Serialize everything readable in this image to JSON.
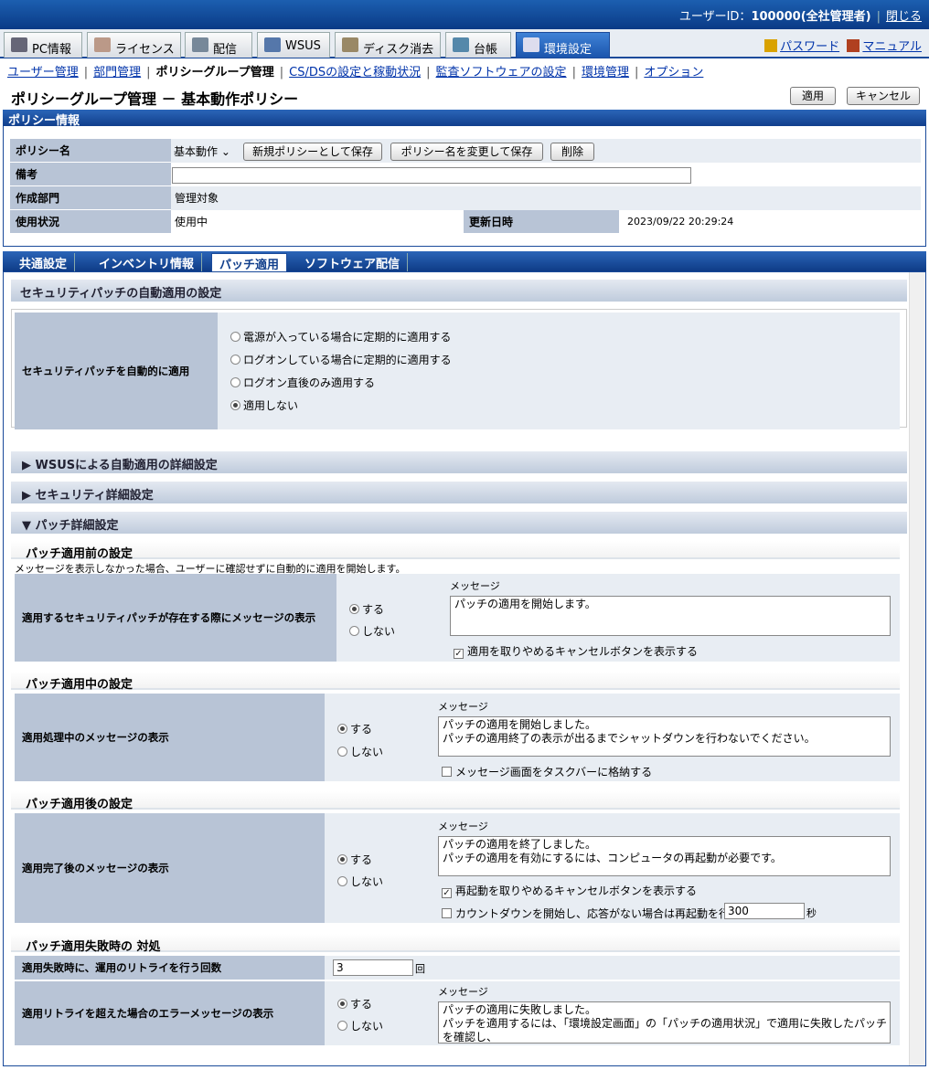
{
  "header": {
    "user_label": "ユーザーID：",
    "user_value": "100000(全社管理者)",
    "logout": "閉じる"
  },
  "main_tabs": [
    {
      "label": "PC情報"
    },
    {
      "label": "ライセンス"
    },
    {
      "label": "配信"
    },
    {
      "label": "WSUS"
    },
    {
      "label": "ディスク消去"
    },
    {
      "label": "台帳"
    },
    {
      "label": "環境設定"
    }
  ],
  "right_links": {
    "password": "パスワード",
    "manual": "マニュアル"
  },
  "submenu": [
    "ユーザー管理",
    "部門管理",
    "ポリシーグループ管理",
    "CS/DSの設定と稼動状況",
    "監査ソフトウェアの設定",
    "環境管理",
    "オプション"
  ],
  "page": {
    "title": "ポリシーグループ管理 － 基本動作ポリシー",
    "apply": "適用",
    "cancel": "キャンセル"
  },
  "policy_info": {
    "section": "ポリシー情報",
    "name_label": "ポリシー名",
    "name_value": "基本動作",
    "save_new": "新規ポリシーとして保存",
    "rename_save": "ポリシー名を変更して保存",
    "delete": "削除",
    "note_label": "備考",
    "dept_label": "作成部門",
    "dept_value": "管理対象",
    "status_label": "使用状況",
    "status_value": "使用中",
    "updated_label": "更新日時",
    "updated_value": "2023/09/22 20:29:24"
  },
  "tabs": [
    "共通設定",
    "インベントリ情報",
    "パッチ適用",
    "ソフトウェア配信"
  ],
  "auto_section": {
    "title": "セキュリティパッチの自動適用の設定",
    "label": "セキュリティパッチを自動的に適用",
    "options": [
      "電源が入っている場合に定期的に適用する",
      "ログオンしている場合に定期的に適用する",
      "ログオン直後のみ適用する",
      "適用しない"
    ]
  },
  "wsus_section": "▶ WSUSによる自動適用の詳細設定",
  "security_section": "▶ セキュリティ詳細設定",
  "patch_section": "▼ パッチ詳細設定",
  "before": {
    "title": "パッチ適用前の設定",
    "note": "メッセージを表示しなかった場合、ユーザーに確認せずに自動的に適用を開始します。",
    "label": "適用するセキュリティパッチが存在する際にメッセージの表示",
    "yes": "する",
    "no": "しない",
    "msg_label": "メッセージ",
    "msg": "パッチの適用を開始します。",
    "check": "適用を取りやめるキャンセルボタンを表示する"
  },
  "during": {
    "title": "パッチ適用中の設定",
    "label": "適用処理中のメッセージの表示",
    "yes": "する",
    "no": "しない",
    "msg_label": "メッセージ",
    "msg": "パッチの適用を開始しました。\nパッチの適用終了の表示が出るまでシャットダウンを行わないでください。",
    "check": "メッセージ画面をタスクバーに格納する"
  },
  "after": {
    "title": "パッチ適用後の設定",
    "label": "適用完了後のメッセージの表示",
    "yes": "する",
    "no": "しない",
    "msg_label": "メッセージ",
    "msg": "パッチの適用を終了しました。\nパッチの適用を有効にするには、コンピュータの再起動が必要です。",
    "check1": "再起動を取りやめるキャンセルボタンを表示する",
    "check2": "カウントダウンを開始し、応答がない場合は再起動を行う",
    "countdown": "300",
    "sec": "秒"
  },
  "failure": {
    "title": "パッチ適用失敗時の 対処",
    "retry_label": "適用失敗時に、運用のリトライを行う回数",
    "retry_value": "3",
    "retry_unit": "回",
    "error_label": "適用リトライを超えた場合のエラーメッセージの表示",
    "yes": "する",
    "no": "しない",
    "msg_label": "メッセージ",
    "msg": "パッチの適用に失敗しました。\nパッチを適用するには、「環境設定画面」の「パッチの適用状況」で適用に失敗したパッチ\nを確認し、"
  }
}
